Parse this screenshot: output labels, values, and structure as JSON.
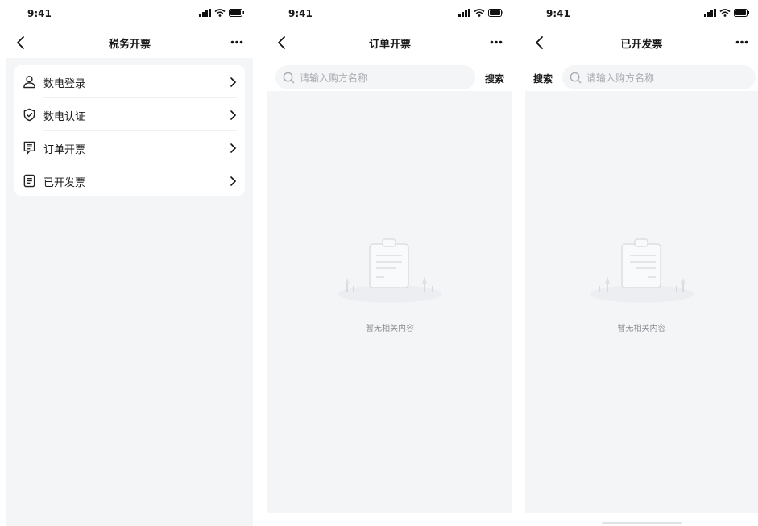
{
  "status_bar": {
    "time": "9:41"
  },
  "screens": [
    {
      "title": "税务开票",
      "menu": [
        {
          "label": "数电登录",
          "icon": "user-icon"
        },
        {
          "label": "数电认证",
          "icon": "shield-check-icon"
        },
        {
          "label": "订单开票",
          "icon": "order-doc-icon"
        },
        {
          "label": "已开发票",
          "icon": "invoice-doc-icon"
        }
      ]
    },
    {
      "title": "订单开票",
      "search": {
        "placeholder": "请输入购方名称",
        "button_label": "搜索"
      },
      "empty_text": "暂无相关内容"
    },
    {
      "title": "已开发票",
      "search": {
        "placeholder": "请输入购方名称",
        "button_label": "搜索"
      },
      "empty_text": "暂无相关内容"
    }
  ],
  "colors": {
    "page_background": "#f4f5f7",
    "card_background": "#ffffff",
    "placeholder_text": "#a9acb2",
    "empty_text": "#8a8d93"
  }
}
